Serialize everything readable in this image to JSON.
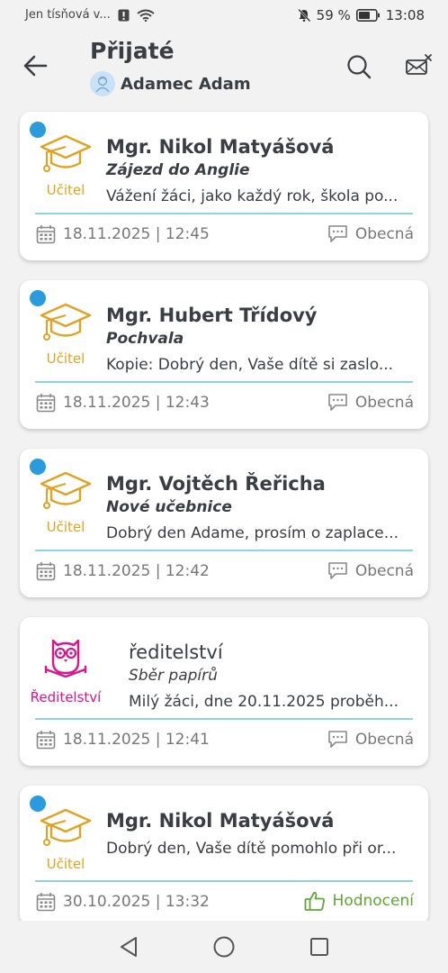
{
  "status_bar": {
    "carrier": "Jen tísňová v...",
    "battery": "59 %",
    "time": "13:08"
  },
  "header": {
    "title": "Přijaté",
    "user_name": "Adamec Adam"
  },
  "messages": [
    {
      "sender": "Mgr. Nikol Matyášová",
      "subject": "Zájezd do Anglie",
      "preview": "Vážení žáci,  jako každý rok, škola po...",
      "role": "Učitel",
      "datetime": "18.11.2025 | 12:45",
      "type": "Obecná",
      "unread": true
    },
    {
      "sender": "Mgr. Hubert Třídový",
      "subject": "Pochvala",
      "preview": "Kopie: Dobrý den, Vaše dítě si zaslo...",
      "role": "Učitel",
      "datetime": "18.11.2025 | 12:43",
      "type": "Obecná",
      "unread": true
    },
    {
      "sender": "Mgr. Vojtěch Řeřicha",
      "subject": "Nové učebnice",
      "preview": "Dobrý den Adame, prosím o zaplace...",
      "role": "Učitel",
      "datetime": "18.11.2025 | 12:42",
      "type": "Obecná",
      "unread": true
    },
    {
      "sender": "ředitelství",
      "subject": "Sběr papírů",
      "preview": "Milý žáci, dne 20.11.2025 proběh...",
      "role": "Ředitelství",
      "datetime": "18.11.2025 | 12:41",
      "type": "Obecná",
      "unread": false
    },
    {
      "sender": "Mgr. Nikol Matyášová",
      "preview": "Dobrý den, Vaše dítě pomohlo při or...",
      "role": "Učitel",
      "datetime": "30.10.2025 | 13:32",
      "type": "Hodnocení",
      "unread": true
    }
  ],
  "colors": {
    "unread_dot": "#2a9bdc",
    "teacher": "#e0a321",
    "director": "#d6168a",
    "divider": "#8fd3e0",
    "evaluation": "#5fa636"
  },
  "icons": {
    "back": "arrow-left-icon",
    "search": "search-icon",
    "mail": "mail-close-icon",
    "teacher": "graduation-cap-icon",
    "director": "owl-icon",
    "date": "calendar-icon",
    "general": "chat-bubble-icon",
    "evaluation": "thumbs-up-icon"
  }
}
